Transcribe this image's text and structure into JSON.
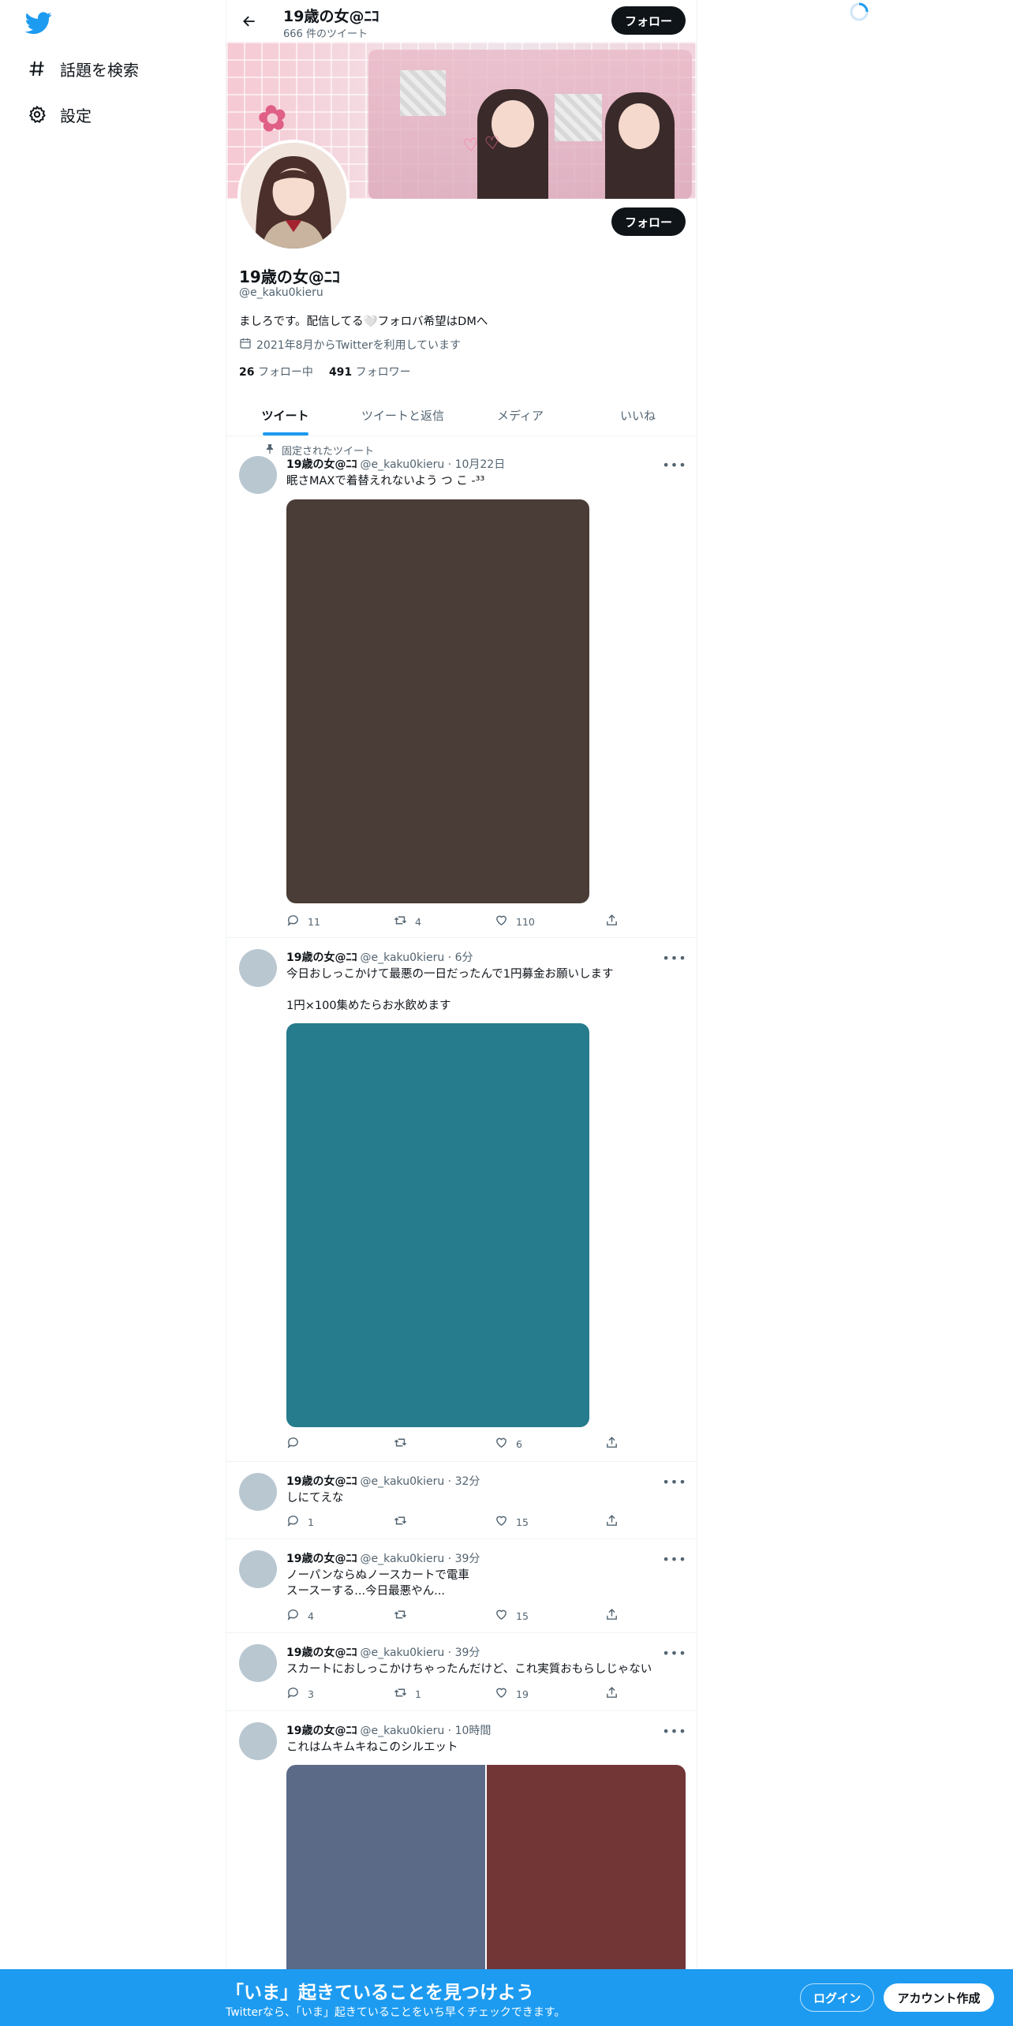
{
  "sidebar": {
    "logo_icon": "twitter-bird-icon",
    "items": [
      {
        "label": "話題を検索",
        "icon": "hashtag-icon"
      },
      {
        "label": "設定",
        "icon": "gear-icon"
      }
    ]
  },
  "header": {
    "title": "19歳の女@ﾆｺ",
    "tweet_count": "666 件のツイート",
    "follow_label": "フォロー"
  },
  "profile": {
    "name": "19歳の女@ﾆｺ",
    "handle": "@e_kaku0kieru",
    "bio": "ましろです。配信してる🤍フォロバ希望はDMへ",
    "joined": "2021年8月からTwitterを利用しています",
    "following_count": "26",
    "following_label": "フォロー中",
    "followers_count": "491",
    "followers_label": "フォロワー",
    "follow_label": "フォロー"
  },
  "tabs": [
    {
      "label": "ツイート",
      "active": true
    },
    {
      "label": "ツイートと返信",
      "active": false
    },
    {
      "label": "メディア",
      "active": false
    },
    {
      "label": "いいね",
      "active": false
    }
  ],
  "tweets": [
    {
      "pinned_label": "固定されたツイート",
      "name": "19歳の女@ﾆｺ",
      "meta": "@e_kaku0kieru · 10月22日",
      "text": "眠さMAXで着替えれないよう  つ こ -³³",
      "media_colors": [
        "#4a3c36"
      ],
      "reply": "11",
      "retweet": "4",
      "like": "110"
    },
    {
      "name": "19歳の女@ﾆｺ",
      "meta": "@e_kaku0kieru · 6分",
      "text": "今日おしっこかけて最悪の一日だったんで1円募金お願いします\n\n1円×100集めたらお水飲めます",
      "media_colors": [
        "#267b8c"
      ],
      "reply": "",
      "retweet": "",
      "like": "6"
    },
    {
      "name": "19歳の女@ﾆｺ",
      "meta": "@e_kaku0kieru · 32分",
      "text": "しにてえな",
      "reply": "1",
      "retweet": "",
      "like": "15"
    },
    {
      "name": "19歳の女@ﾆｺ",
      "meta": "@e_kaku0kieru · 39分",
      "text": "ノーパンならぬノースカートで電車\nスースーする...今日最悪やん...",
      "reply": "4",
      "retweet": "",
      "like": "15"
    },
    {
      "name": "19歳の女@ﾆｺ",
      "meta": "@e_kaku0kieru · 39分",
      "text": "スカートにおしっこかけちゃったんだけど、これ実質おもらしじゃない",
      "reply": "3",
      "retweet": "1",
      "like": "19"
    },
    {
      "name": "19歳の女@ﾆｺ",
      "meta": "@e_kaku0kieru · 10時間",
      "text": "これはムキムキねこのシルエット",
      "media_colors": [
        "#5a6a87",
        "#723637"
      ]
    }
  ],
  "bottom_bar": {
    "title": "「いま」起きていることを見つけよう",
    "subtitle": "Twitterなら、「いま」起きていることをいち早くチェックできます。",
    "login_label": "ログイン",
    "signup_label": "アカウント作成"
  },
  "colors": {
    "accent": "#1d9bf0",
    "text": "#0f1419",
    "secondary": "#536471"
  }
}
